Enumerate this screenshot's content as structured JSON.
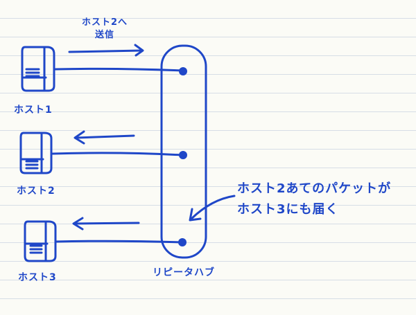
{
  "send_label": {
    "line1": "ホスト2へ",
    "line2": "送信"
  },
  "hosts": [
    {
      "label": "ホスト1"
    },
    {
      "label": "ホスト2"
    },
    {
      "label": "ホスト3"
    }
  ],
  "hub": {
    "label": "リピータハブ"
  },
  "annotation": {
    "line1": "ホスト2あてのパケットが",
    "line2": "ホスト3にも届く"
  },
  "colors": {
    "ink": "#1f47c8",
    "paper": "#fbfbf6",
    "rule": "#d6dde6"
  }
}
